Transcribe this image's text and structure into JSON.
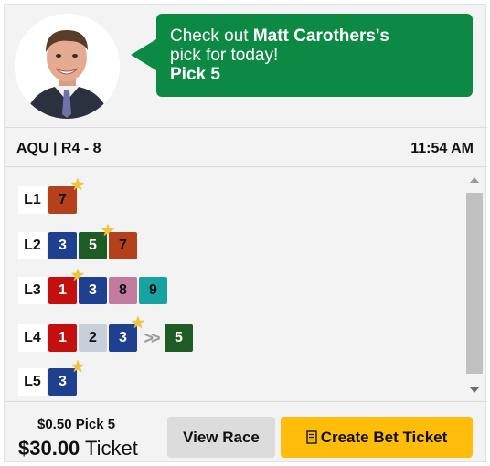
{
  "header": {
    "avatar_alt": "Matt Carothers",
    "bubble": {
      "prefix": "Check out ",
      "handicapper": "Matt Carothers's",
      "line2": "pick for today!",
      "bet_type": "Pick 5"
    }
  },
  "race": {
    "id": "AQU | R4 - 8",
    "time": "11:54 AM"
  },
  "legs": [
    {
      "label": "L1",
      "horses": [
        {
          "num": "7",
          "bg": "#b5411b",
          "fg": "#111111",
          "star": true
        }
      ]
    },
    {
      "label": "L2",
      "horses": [
        {
          "num": "3",
          "bg": "#1f3f8f",
          "fg": "#ffffff",
          "star": false
        },
        {
          "num": "5",
          "bg": "#1e5b25",
          "fg": "#ffffff",
          "star": true
        },
        {
          "num": "7",
          "bg": "#b5411b",
          "fg": "#111111",
          "star": false
        }
      ]
    },
    {
      "label": "L3",
      "horses": [
        {
          "num": "1",
          "bg": "#c40f0f",
          "fg": "#ffffff",
          "star": true
        },
        {
          "num": "3",
          "bg": "#1f3f8f",
          "fg": "#ffffff",
          "star": false
        },
        {
          "num": "8",
          "bg": "#c27a9e",
          "fg": "#111111",
          "star": false
        },
        {
          "num": "9",
          "bg": "#17a4a0",
          "fg": "#111111",
          "star": false
        }
      ]
    },
    {
      "label": "L4",
      "horses": [
        {
          "num": "1",
          "bg": "#c40f0f",
          "fg": "#ffffff",
          "star": false
        },
        {
          "num": "2",
          "bg": "#c7cfda",
          "fg": "#111111",
          "star": false
        },
        {
          "num": "3",
          "bg": "#1f3f8f",
          "fg": "#ffffff",
          "star": true
        },
        {
          "num": ">>",
          "chev": true
        },
        {
          "num": "5",
          "bg": "#1e5b25",
          "fg": "#ffffff",
          "star": false
        }
      ]
    },
    {
      "label": "L5",
      "horses": [
        {
          "num": "3",
          "bg": "#1f3f8f",
          "fg": "#ffffff",
          "star": true
        }
      ]
    }
  ],
  "footer": {
    "cost": "$0.50 Pick 5",
    "ticket_amount": "$30.00",
    "ticket_word": " Ticket",
    "view_race_label": "View Race",
    "create_ticket_label": "Create Bet Ticket"
  },
  "colors": {
    "bubble": "#0c8a43",
    "create_button": "#ffbd0a",
    "view_button": "#dcdcdc",
    "star": "#f2c438"
  },
  "icons": {
    "star": "star-icon",
    "ticket": "ticket-icon",
    "scroll_up": "chevron-up-icon",
    "scroll_down": "chevron-down-icon"
  }
}
